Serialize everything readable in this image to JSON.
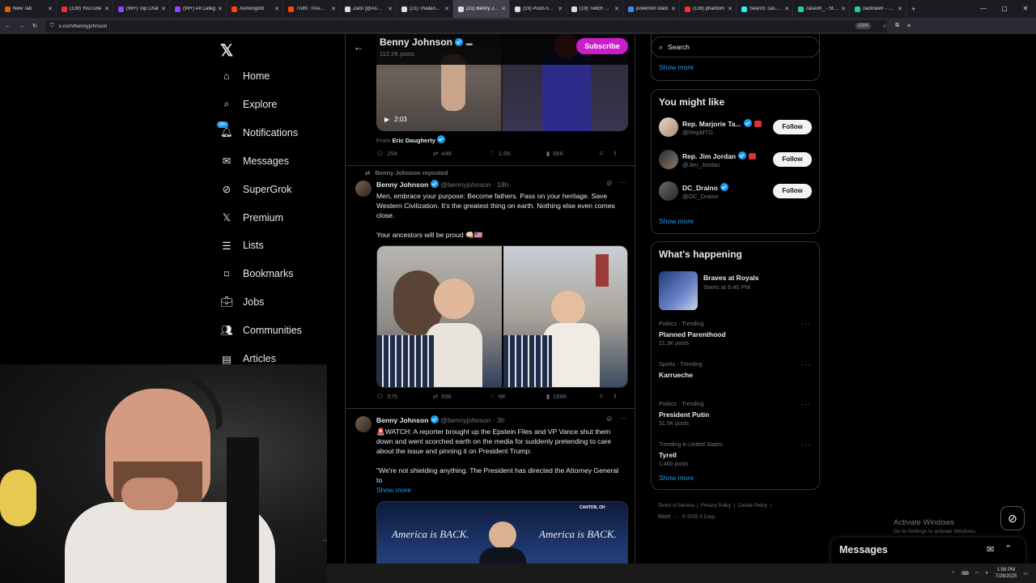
{
  "browser": {
    "tabs": [
      {
        "label": "New Tab",
        "icon": "firefox-icon"
      },
      {
        "label": "(139) YouTube",
        "icon": "youtube-icon"
      },
      {
        "label": "(99+) Top Chat",
        "icon": "twitch-icon"
      },
      {
        "label": "(99+) All Categ",
        "icon": "twitch-icon"
      },
      {
        "label": "Asmongold",
        "icon": "reddit-icon"
      },
      {
        "label": "Truth : r/Asmon",
        "icon": "reddit-icon"
      },
      {
        "label": "Zack (@Asmon",
        "icon": "x-icon"
      },
      {
        "label": "(21) Thailand a",
        "icon": "x-icon"
      },
      {
        "label": "(21) Benny Johi",
        "icon": "x-icon"
      },
      {
        "label": "(19) Posts liked",
        "icon": "x-icon"
      },
      {
        "label": "(19) Twitch Sup",
        "icon": "x-icon"
      },
      {
        "label": "pokemon stadi",
        "icon": "google-icon"
      },
      {
        "label": "(139) phantom",
        "icon": "youtube-icon"
      },
      {
        "label": "Search: caseoh",
        "icon": "tiktok-icon"
      },
      {
        "label": "caseoh_ - Strea",
        "icon": "streamselements-icon"
      },
      {
        "label": "zackrawrr - Stre",
        "icon": "streamselements-icon"
      }
    ],
    "active_tab": 8,
    "url": "x.com/bennyjohnson",
    "zoom": "120%"
  },
  "nav": {
    "items": [
      {
        "label": "Home",
        "icon": "home-icon"
      },
      {
        "label": "Explore",
        "icon": "search-icon"
      },
      {
        "label": "Notifications",
        "icon": "bell-icon",
        "badge": "20+"
      },
      {
        "label": "Messages",
        "icon": "envelope-icon"
      },
      {
        "label": "SuperGrok",
        "icon": "grok-icon"
      },
      {
        "label": "Premium",
        "icon": "x-logo-icon"
      },
      {
        "label": "Lists",
        "icon": "list-icon"
      },
      {
        "label": "Bookmarks",
        "icon": "bookmark-icon"
      },
      {
        "label": "Jobs",
        "icon": "briefcase-icon"
      },
      {
        "label": "Communities",
        "icon": "people-icon"
      },
      {
        "label": "Articles",
        "icon": "article-icon"
      }
    ]
  },
  "profile": {
    "name": "Benny Johnson",
    "post_count": "112.2K posts",
    "subscribe_label": "Subscribe"
  },
  "post1": {
    "video_duration": "2:03",
    "from_prefix": "From",
    "from_name": "Eric Daugherty",
    "replies": "294",
    "reposts": "448",
    "likes": "1.6K",
    "views": "66K"
  },
  "post2": {
    "repost_label": "Benny Johnson reposted",
    "name": "Benny Johnson",
    "handle": "@bennyjohnson",
    "time": "· 18h",
    "text1": "Men, embrace your purpose: Become fathers. Pass on your heritage. Save Western Civilization. It's the greatest thing on earth. Nothing else even comes close.",
    "text2": "Your ancestors will be proud 👊🏻🇺🇸",
    "replies": "575",
    "reposts": "696",
    "likes": "6K",
    "views": "186K"
  },
  "post3": {
    "name": "Benny Johnson",
    "handle": "@bennyjohnson",
    "time": "· 3h",
    "text1": "🚨WATCH: A reporter brought up the Epstein Files and VP Vance shut them down and went scorched earth on the media for suddenly pretending to care about the issue and pinning it on President Trump:",
    "text2": "\"We're not shielding anything. The President has directed the Attorney General to",
    "show_more": "Show more",
    "video_banner_left": "America is BACK.",
    "video_banner_right": "America is BACK.",
    "location": "CANTON, OH"
  },
  "right": {
    "search_placeholder": "Search",
    "show_more_top": "Show more",
    "might_like_title": "You might like",
    "suggestions": [
      {
        "name": "Rep. Marjorie Ta...",
        "handle": "@RepMTG",
        "follow": "Follow"
      },
      {
        "name": "Rep. Jim Jordan",
        "handle": "@Jim_Jordan",
        "follow": "Follow"
      },
      {
        "name": "DC_Draino",
        "handle": "@DC_Draino",
        "follow": "Follow"
      }
    ],
    "show_more_mid": "Show more",
    "happening_title": "What's happening",
    "event": {
      "title": "Braves at Royals",
      "time": "Starts at 6:40 PM"
    },
    "trends": [
      {
        "context": "Politics · Trending",
        "name": "Planned Parenthood",
        "posts": "21.3K posts"
      },
      {
        "context": "Sports · Trending",
        "name": "Karrueche",
        "posts": ""
      },
      {
        "context": "Politics · Trending",
        "name": "President Putin",
        "posts": "31.5K posts"
      },
      {
        "context": "Trending in United States",
        "name": "Tyrell",
        "posts": "1,460 posts"
      }
    ],
    "show_more_bottom": "Show more",
    "footer": {
      "terms": "Terms of Service",
      "privacy": "Privacy Policy",
      "cookie": "Cookie Policy",
      "more": "More ···",
      "copyright": "© 2025 X Corp."
    }
  },
  "messages_dock": {
    "label": "Messages"
  },
  "windows": {
    "activate_title": "Activate Windows",
    "activate_sub": "Go to Settings to activate Windows.",
    "time": "1:56 PM",
    "date": "7/28/2025"
  },
  "colors": {
    "accent": "#1d9bf0",
    "subscribe": "#c91ec9",
    "border": "#2f3336",
    "muted": "#71767b"
  }
}
